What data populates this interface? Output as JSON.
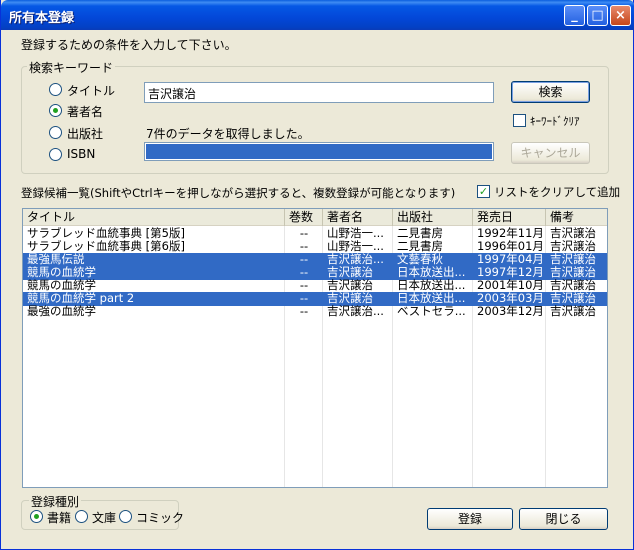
{
  "window": {
    "title": "所有本登録",
    "minimize": "_",
    "maximize": "□",
    "close": "×"
  },
  "instruction": "登録するための条件を入力して下さい。",
  "search_group": {
    "title": "検索キーワード",
    "options": [
      {
        "label": "タイトル",
        "selected": false
      },
      {
        "label": "著者名",
        "selected": true
      },
      {
        "label": "出版社",
        "selected": false
      },
      {
        "label": "ISBN",
        "selected": false
      }
    ],
    "keyword_value": "吉沢譲治",
    "status_text": "7件のデータを取得しました。",
    "progress": 1.0,
    "search_button": "検索",
    "clear_keyword_label": "ｷｰﾜｰﾄﾞｸﾘｱ",
    "clear_keyword_checked": false,
    "cancel_button": "キャンセル"
  },
  "candidate_list": {
    "caption": "登録候補一覧(ShiftやCtrlキーを押しながら選択すると、複数登録が可能となります)",
    "clear_and_add_label": "リストをクリアして追加",
    "clear_and_add_checked": true,
    "columns": [
      "タイトル",
      "巻数",
      "著者名",
      "出版社",
      "発売日",
      "備考"
    ],
    "rows": [
      {
        "title": "サラブレッド血統事典 [第5版]",
        "volume": "--",
        "author": "山野浩一...",
        "publisher": "二見書房",
        "date": "1992年11月",
        "note": "吉沢譲治",
        "selected": false
      },
      {
        "title": "サラブレッド血統事典 [第6版]",
        "volume": "--",
        "author": "山野浩一...",
        "publisher": "二見書房",
        "date": "1996年01月",
        "note": "吉沢譲治",
        "selected": false
      },
      {
        "title": "最強馬伝説",
        "volume": "--",
        "author": "吉沢譲治...",
        "publisher": "文藝春秋",
        "date": "1997年04月",
        "note": "吉沢譲治",
        "selected": true
      },
      {
        "title": "競馬の血統学",
        "volume": "--",
        "author": "吉沢譲治",
        "publisher": "日本放送出...",
        "date": "1997年12月",
        "note": "吉沢譲治",
        "selected": true
      },
      {
        "title": "競馬の血統学",
        "volume": "--",
        "author": "吉沢譲治",
        "publisher": "日本放送出...",
        "date": "2001年10月",
        "note": "吉沢譲治",
        "selected": false
      },
      {
        "title": "競馬の血統学 part 2",
        "volume": "--",
        "author": "吉沢譲治",
        "publisher": "日本放送出...",
        "date": "2003年03月",
        "note": "吉沢譲治",
        "selected": true
      },
      {
        "title": "最強の血統学",
        "volume": "--",
        "author": "吉沢譲治...",
        "publisher": "ベストセラ...",
        "date": "2003年12月",
        "note": "吉沢譲治",
        "selected": false
      }
    ]
  },
  "type_group": {
    "title": "登録種別",
    "options": [
      {
        "label": "書籍",
        "selected": true
      },
      {
        "label": "文庫",
        "selected": false
      },
      {
        "label": "コミック",
        "selected": false
      }
    ]
  },
  "buttons": {
    "register": "登録",
    "close": "閉じる"
  },
  "colors": {
    "selection": "#316ac5",
    "title_bar": "#0347d8",
    "face": "#ece9d8"
  }
}
